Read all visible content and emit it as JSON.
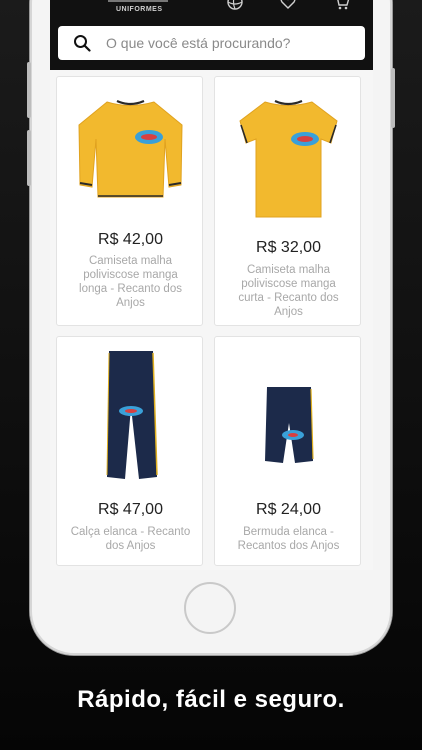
{
  "header": {
    "brand": "UNIFORMES",
    "icons": [
      "ball-icon",
      "heart-icon",
      "cart-icon"
    ]
  },
  "search": {
    "placeholder": "O que você está procurando?"
  },
  "products": [
    {
      "price": "R$ 42,00",
      "name": "Camiseta malha poliviscose manga longa - Recanto dos Anjos",
      "image": "yellow-longsleeve-shirt"
    },
    {
      "price": "R$ 32,00",
      "name": "Camiseta malha poliviscose manga curta - Recanto dos Anjos",
      "image": "yellow-shortsleeve-shirt"
    },
    {
      "price": "R$ 47,00",
      "name": "Calça elanca - Recanto dos Anjos",
      "image": "navy-pants"
    },
    {
      "price": "R$ 24,00",
      "name": "Bermuda elanca - Recantos dos Anjos",
      "image": "navy-shorts"
    }
  ],
  "tagline": "Rápido, fácil e seguro.",
  "colors": {
    "shirt": "#f2b92e",
    "pants": "#1c2a4a",
    "appbar": "#111111"
  }
}
